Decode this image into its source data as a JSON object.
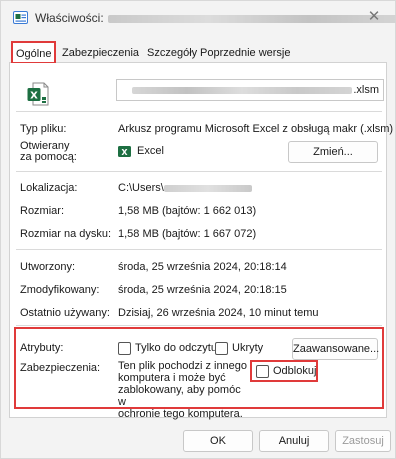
{
  "window": {
    "title_prefix": "Właściwości:",
    "close_glyph": "✕"
  },
  "tabs": [
    {
      "label": "Ogólne"
    },
    {
      "label": "Zabezpieczenia"
    },
    {
      "label": "Szczegóły"
    },
    {
      "label": "Poprzednie wersje"
    }
  ],
  "file": {
    "name_suffix": ".xlsm"
  },
  "rows": {
    "type_label": "Typ pliku:",
    "type_value": "Arkusz programu Microsoft Excel z obsługą makr (.xlsm)",
    "opens_with_label_1": "Otwierany",
    "opens_with_label_2": "za pomocą:",
    "opens_with_value": "Excel",
    "change_button": "Zmień...",
    "location_label": "Lokalizacja:",
    "location_prefix": "C:\\Users\\",
    "size_label": "Rozmiar:",
    "size_value": "1,58 MB (bajtów: 1 662 013)",
    "size_on_disk_label": "Rozmiar na dysku:",
    "size_on_disk_value": "1,58 MB (bajtów: 1 667 072)",
    "created_label": "Utworzony:",
    "created_value": "środa, 25 września 2024, 20:18:14",
    "modified_label": "Zmodyfikowany:",
    "modified_value": "środa, 25 września 2024, 20:18:15",
    "accessed_label": "Ostatnio używany:",
    "accessed_value": "Dzisiaj, 26 września 2024, 10 minut temu"
  },
  "attributes": {
    "label": "Atrybuty:",
    "readonly": "Tylko do odczytu",
    "hidden": "Ukryty",
    "advanced_button": "Zaawansowane..."
  },
  "security": {
    "label": "Zabezpieczenia:",
    "line1": "Ten plik pochodzi z innego",
    "line2": "komputera i może być",
    "line3": "zablokowany, aby pomóc w",
    "line4": "ochronie tego komputera.",
    "unblock": "Odblokuj"
  },
  "footer": {
    "ok": "OK",
    "cancel": "Anuluj",
    "apply": "Zastosuj"
  },
  "colors": {
    "highlight": "#e03a3a",
    "excel_green": "#1d6f42"
  }
}
